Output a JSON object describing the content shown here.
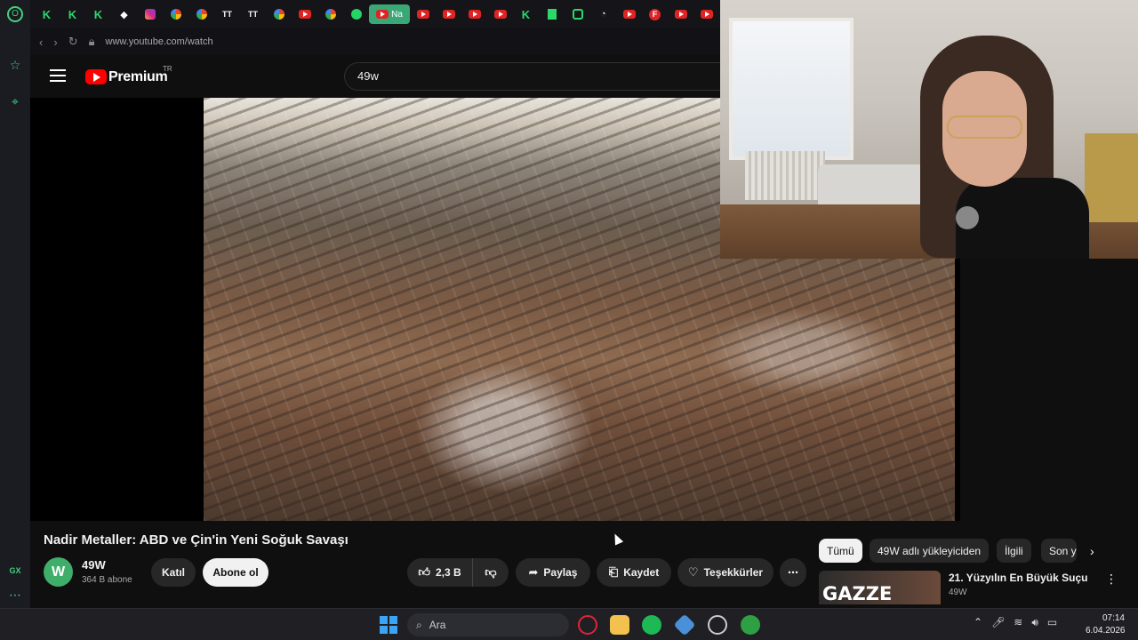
{
  "browser": {
    "url": "www.youtube.com/watch",
    "sidebar_bottom_label": "GX",
    "active_tab_label": "Na",
    "tabs": [
      "k",
      "k",
      "k",
      "diamond",
      "instagram",
      "google",
      "google",
      "tt",
      "tt",
      "google",
      "youtube",
      "google",
      "whatsapp",
      "youtube-active",
      "youtube",
      "youtube",
      "youtube",
      "youtube",
      "k",
      "doc",
      "square",
      "clock",
      "youtube",
      "f",
      "youtube",
      "youtube"
    ]
  },
  "youtube": {
    "logo_text": "Premium",
    "region": "TR",
    "search_query": "49w"
  },
  "video": {
    "title": "Nadir Metaller: ABD ve Çin'in Yeni Soğuk Savaşı"
  },
  "channel": {
    "name": "49W",
    "subscribers": "364 B abone",
    "avatar_letter": "W",
    "join_label": "Katıl",
    "subscribe_label": "Abone ol"
  },
  "actions": {
    "likes": "2,3 B",
    "share": "Paylaş",
    "save": "Kaydet",
    "thanks": "Teşekkürler"
  },
  "chips": [
    "Tümü",
    "49W adlı yükleyiciden",
    "İlgili",
    "Son y"
  ],
  "recommendation": {
    "thumb_text": "GAZZE",
    "title": "21. Yüzyılın En Büyük Suçu",
    "channel": "49W"
  },
  "taskbar": {
    "search_placeholder": "Ara",
    "time": "07:14",
    "date": "6.04.2026"
  },
  "colors": {
    "accent_green": "#3aa876",
    "youtube_red": "#ff0000",
    "background": "#0f0f0f"
  }
}
